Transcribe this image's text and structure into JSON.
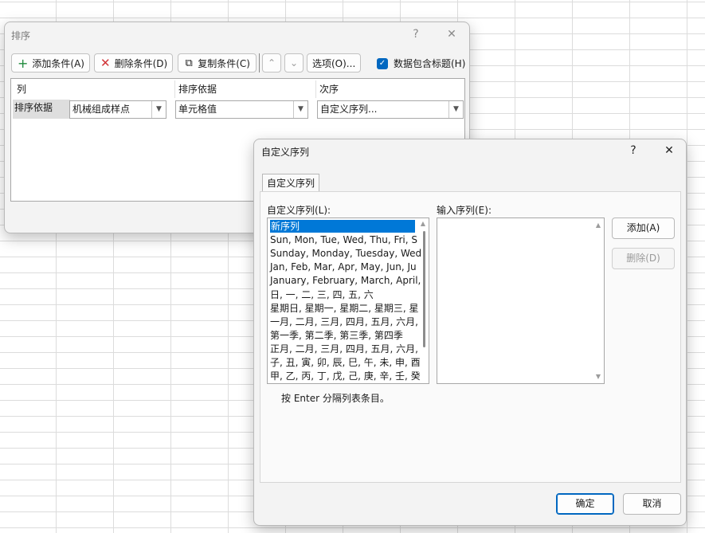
{
  "sort_dialog": {
    "title": "排序",
    "help": "?",
    "close": "✕",
    "toolbar": {
      "add_condition": "添加条件(A)",
      "delete_condition": "删除条件(D)",
      "copy_condition": "复制条件(C)",
      "up": "⌃",
      "down": "⌄",
      "options": "选项(O)...",
      "has_headers_label": "数据包含标题(H)",
      "has_headers_checked": true
    },
    "columns": {
      "col": "列",
      "sort_on": "排序依据",
      "order": "次序"
    },
    "row": {
      "label": "排序依据",
      "column_value": "机械组成样点",
      "sort_on_value": "单元格值",
      "order_value": "自定义序列..."
    }
  },
  "custom_dialog": {
    "title": "自定义序列",
    "help": "?",
    "close": "✕",
    "tab": "自定义序列",
    "lists_label": "自定义序列(L):",
    "entries_label": "输入序列(E):",
    "lists": [
      "新序列",
      "Sun, Mon, Tue, Wed, Thu, Fri, S",
      "Sunday, Monday, Tuesday, Wed",
      "Jan, Feb, Mar, Apr, May, Jun, Ju",
      "January, February, March, April,",
      "日, 一, 二, 三, 四, 五, 六",
      "星期日, 星期一, 星期二, 星期三, 星",
      "一月, 二月, 三月, 四月, 五月, 六月,",
      "第一季, 第二季, 第三季, 第四季",
      "正月, 二月, 三月, 四月, 五月, 六月,",
      "子, 丑, 寅, 卯, 辰, 巳, 午, 未, 申, 酉",
      "甲, 乙, 丙, 丁, 戊, 己, 庚, 辛, 壬, 癸"
    ],
    "selected_index": 0,
    "add_button": "添加(A)",
    "delete_button": "删除(D)",
    "hint": "按 Enter 分隔列表条目。",
    "ok_button": "确定",
    "cancel_button": "取消"
  }
}
